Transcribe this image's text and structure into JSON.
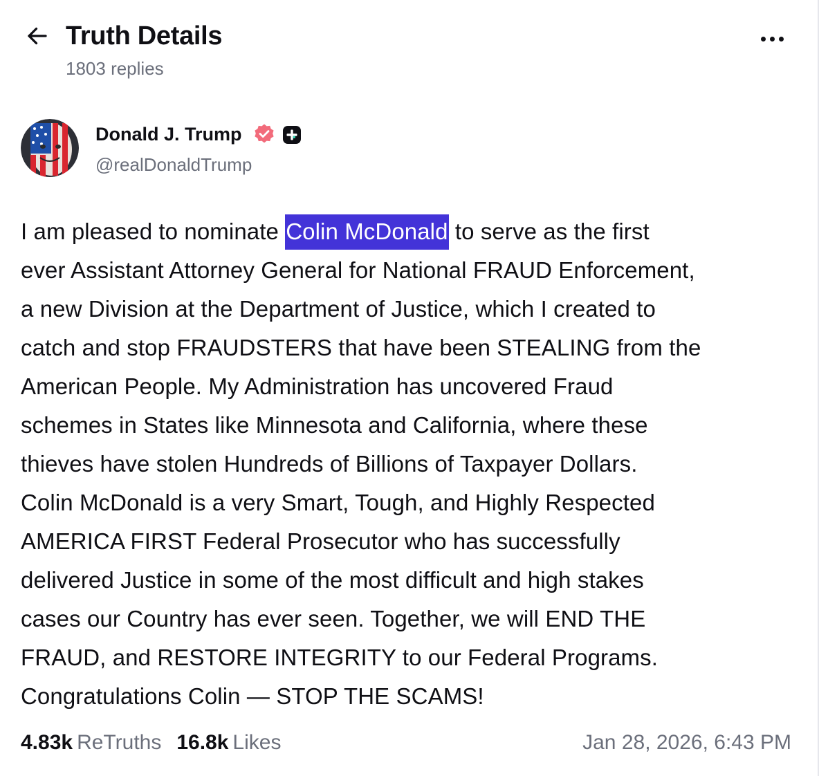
{
  "header": {
    "title": "Truth Details",
    "replies": "1803 replies",
    "back_icon": "arrow-left-icon",
    "more_icon": "more-horizontal-icon"
  },
  "author": {
    "name": "Donald J. Trump",
    "handle": "@realDonaldTrump",
    "verified_icon": "verified-badge-icon",
    "verified_color": "#f26b7b",
    "plus_icon": "truth-plus-icon"
  },
  "post": {
    "lines": [
      {
        "before": "I am pleased to nominate ",
        "highlight": "Colin McDonald",
        "after": " to serve as the first"
      },
      {
        "text": "ever Assistant Attorney General for National FRAUD Enforcement,"
      },
      {
        "text": "a new Division at the Department of Justice, which I created to"
      },
      {
        "text": "catch and stop FRAUDSTERS that have been STEALING from the"
      },
      {
        "text": "American People. My Administration has uncovered Fraud"
      },
      {
        "text": "schemes in States like Minnesota and California, where these"
      },
      {
        "text": "thieves have stolen Hundreds of Billions of Taxpayer Dollars."
      },
      {
        "text": "Colin McDonald is a very Smart, Tough, and Highly Respected"
      },
      {
        "text": "AMERICA FIRST Federal Prosecutor who has successfully"
      },
      {
        "text": "delivered Justice in some of the most difficult and high stakes"
      },
      {
        "text": "cases our Country has ever seen. Together, we will END THE"
      },
      {
        "text": "FRAUD, and RESTORE INTEGRITY to our Federal Programs."
      },
      {
        "text": "Congratulations Colin — STOP THE SCAMS!"
      }
    ],
    "highlight_color": "#4333d8"
  },
  "stats": {
    "retruths_count": "4.83k",
    "retruths_label": "ReTruths",
    "likes_count": "16.8k",
    "likes_label": "Likes"
  },
  "timestamp": "Jan 28, 2026, 6:43 PM"
}
